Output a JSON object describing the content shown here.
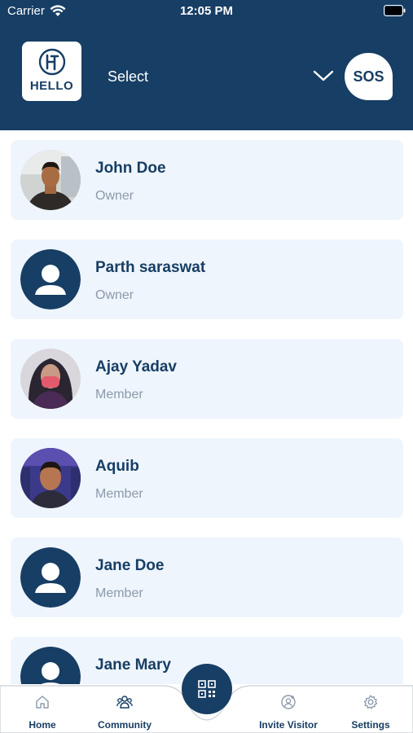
{
  "status_bar": {
    "carrier": "Carrier",
    "time": "12:05 PM"
  },
  "header": {
    "logo_text": "HELLO",
    "select_label": "Select",
    "sos_label": "SOS"
  },
  "members": [
    {
      "name": "John Doe",
      "role": "Owner",
      "avatar": "photo"
    },
    {
      "name": "Parth saraswat",
      "role": "Owner",
      "avatar": "placeholder"
    },
    {
      "name": "Ajay Yadav",
      "role": "Member",
      "avatar": "photo"
    },
    {
      "name": "Aquib",
      "role": "Member",
      "avatar": "photo"
    },
    {
      "name": "Jane Doe",
      "role": "Member",
      "avatar": "placeholder"
    },
    {
      "name": "Jane Mary",
      "role": "",
      "avatar": "placeholder"
    }
  ],
  "bottom_nav": {
    "items": [
      {
        "label": "Home",
        "icon": "home-icon"
      },
      {
        "label": "Community",
        "icon": "community-icon"
      },
      {
        "label": "Invite Visitor",
        "icon": "invite-visitor-icon"
      },
      {
        "label": "Settings",
        "icon": "gear-icon"
      }
    ],
    "center_icon": "qr-code-icon"
  },
  "colors": {
    "primary": "#173e64",
    "card": "#eff5fd",
    "muted": "#8b9aab"
  }
}
